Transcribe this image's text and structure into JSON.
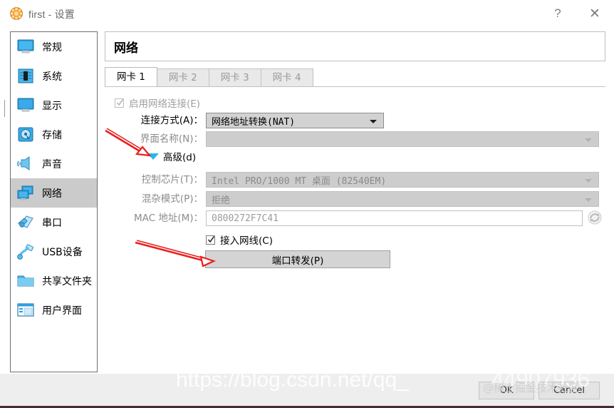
{
  "window": {
    "title": "first - 设置",
    "icon": "virtualbox-icon",
    "help_label": "?",
    "close_label": "✕"
  },
  "sidebar": {
    "items": [
      {
        "label": "常规",
        "icon": "monitor-icon",
        "selected": false
      },
      {
        "label": "系统",
        "icon": "chip-icon",
        "selected": false
      },
      {
        "label": "显示",
        "icon": "display-icon",
        "selected": false
      },
      {
        "label": "存储",
        "icon": "harddisk-icon",
        "selected": false
      },
      {
        "label": "声音",
        "icon": "speaker-icon",
        "selected": false
      },
      {
        "label": "网络",
        "icon": "network-icon",
        "selected": true
      },
      {
        "label": "串口",
        "icon": "serialport-icon",
        "selected": false
      },
      {
        "label": "USB设备",
        "icon": "usb-icon",
        "selected": false
      },
      {
        "label": "共享文件夹",
        "icon": "folder-icon",
        "selected": false
      },
      {
        "label": "用户界面",
        "icon": "userinterface-icon",
        "selected": false
      }
    ]
  },
  "main": {
    "page_title": "网络",
    "tabs": [
      {
        "label": "网卡 1",
        "active": true
      },
      {
        "label": "网卡 2",
        "active": false
      },
      {
        "label": "网卡 3",
        "active": false
      },
      {
        "label": "网卡 4",
        "active": false
      }
    ],
    "enable_network": {
      "label": "启用网络连接(E)",
      "checked": true,
      "enabled": false
    },
    "fields": {
      "attached_to": {
        "label": "连接方式(A)：",
        "value": "网络地址转换(NAT)",
        "enabled": true
      },
      "interface_name": {
        "label": "界面名称(N)：",
        "value": "",
        "enabled": false
      },
      "adapter_type": {
        "label": "控制芯片(T)：",
        "value": "Intel PRO/1000 MT 桌面 (82540EM)",
        "enabled": false
      },
      "promiscuous_mode": {
        "label": "混杂模式(P)：",
        "value": "拒绝",
        "enabled": false
      },
      "mac_address": {
        "label": "MAC 地址(M)：",
        "value": "0800272F7C41",
        "enabled": false,
        "refresh_icon": "refresh-mac-icon"
      }
    },
    "advanced": {
      "label": "高级(d)",
      "expanded": true,
      "icon": "triangle-down-icon",
      "color": "#29b6f0"
    },
    "cable_connected": {
      "label": "接入网线(C)",
      "checked": true,
      "enabled": true
    },
    "port_forwarding_button": "端口转发(P)"
  },
  "footer": {
    "ok_label": "OK",
    "cancel_label": "Cancel"
  },
  "watermarks": {
    "url": "https://blog.csdn.net/qq_",
    "number": "44907936",
    "community": "@稀土掘金技术社区"
  },
  "annotations": {
    "color": "#e8201f",
    "arrows": [
      {
        "name": "arrow-to-advanced",
        "target": "高级(d)"
      },
      {
        "name": "arrow-to-port-forwarding",
        "target": "端口转发(P)"
      }
    ]
  }
}
